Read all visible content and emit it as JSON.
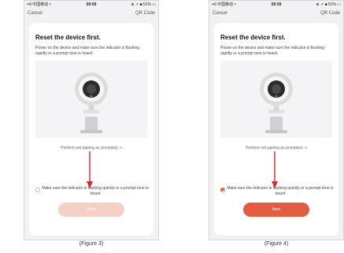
{
  "status_bar": {
    "carrier": "••ll 中国移动 ≈",
    "time": "09:09",
    "right": "⊕ ↗ ■ 51% ▭"
  },
  "nav": {
    "cancel": "Cancel",
    "qr_code": "QR Code"
  },
  "card": {
    "title": "Reset the device first.",
    "description": "Power on the device and make sure the indicator is flashing rapidly or a prompt tone is heard.",
    "pair_link": "Perform net pairing as prompted. >",
    "check_label": "Make sure the indicator is flashing quickly or a prompt tone is heard",
    "next_label": "Next"
  },
  "figures": [
    {
      "caption": "(Figure 3)",
      "checked": false
    },
    {
      "caption": "(Figure 4)",
      "checked": true
    }
  ],
  "colors": {
    "accent": "#e25c40",
    "accent_disabled": "#f6cfc5",
    "arrow": "#e0242b",
    "background": "#f2f2f4"
  }
}
